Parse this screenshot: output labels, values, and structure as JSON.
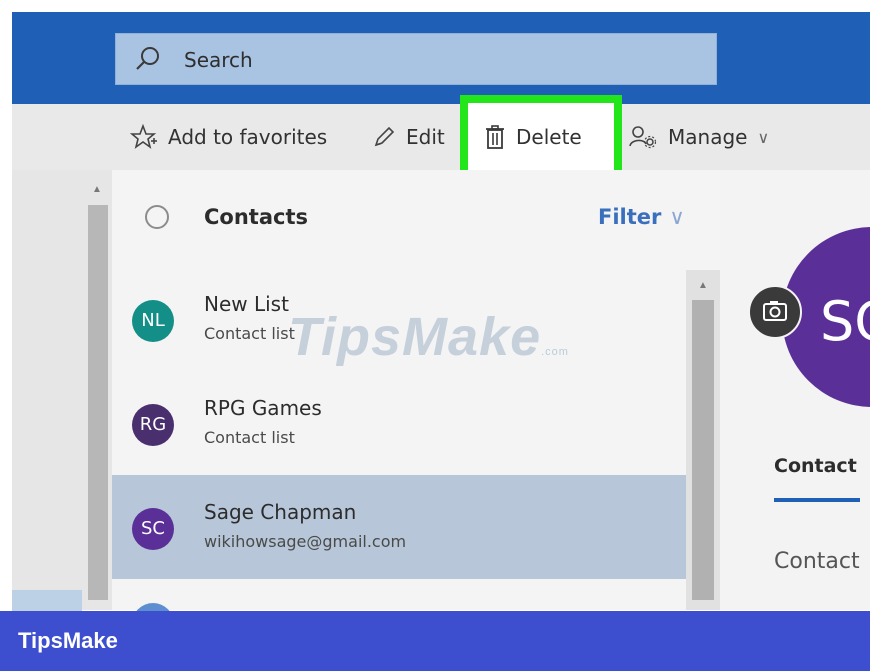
{
  "search": {
    "placeholder": "Search"
  },
  "toolbar": {
    "add_to_favorites": "Add to favorites",
    "edit": "Edit",
    "delete": "Delete",
    "manage": "Manage",
    "manage_chevron": "∨"
  },
  "list": {
    "title": "Contacts",
    "filter_label": "Filter",
    "filter_chevron": "∨",
    "items": [
      {
        "initials": "NL",
        "name": "New List",
        "sub": "Contact list",
        "color": "#138f87"
      },
      {
        "initials": "RG",
        "name": "RPG Games",
        "sub": "Contact list",
        "color": "#4a2f6e"
      },
      {
        "initials": "SC",
        "name": "Sage Chapman",
        "sub": "wikihowsage@gmail.com",
        "color": "#5b2f98"
      }
    ]
  },
  "detail": {
    "initials": "SC",
    "tab_contact": "Contact",
    "section_label": "Contact"
  },
  "watermark": {
    "text": "TipsMake",
    "suffix": ".com"
  },
  "banner": {
    "brand": "TipsMake"
  },
  "colors": {
    "topbar": "#1f5fb6",
    "highlight": "#22e51a",
    "selected_row": "#b7c7d9",
    "banner": "#3d4fcf"
  },
  "icons": [
    "search-icon",
    "star-add-icon",
    "pencil-icon",
    "trash-icon",
    "manage-people-icon",
    "camera-icon",
    "chevron-down-icon"
  ]
}
